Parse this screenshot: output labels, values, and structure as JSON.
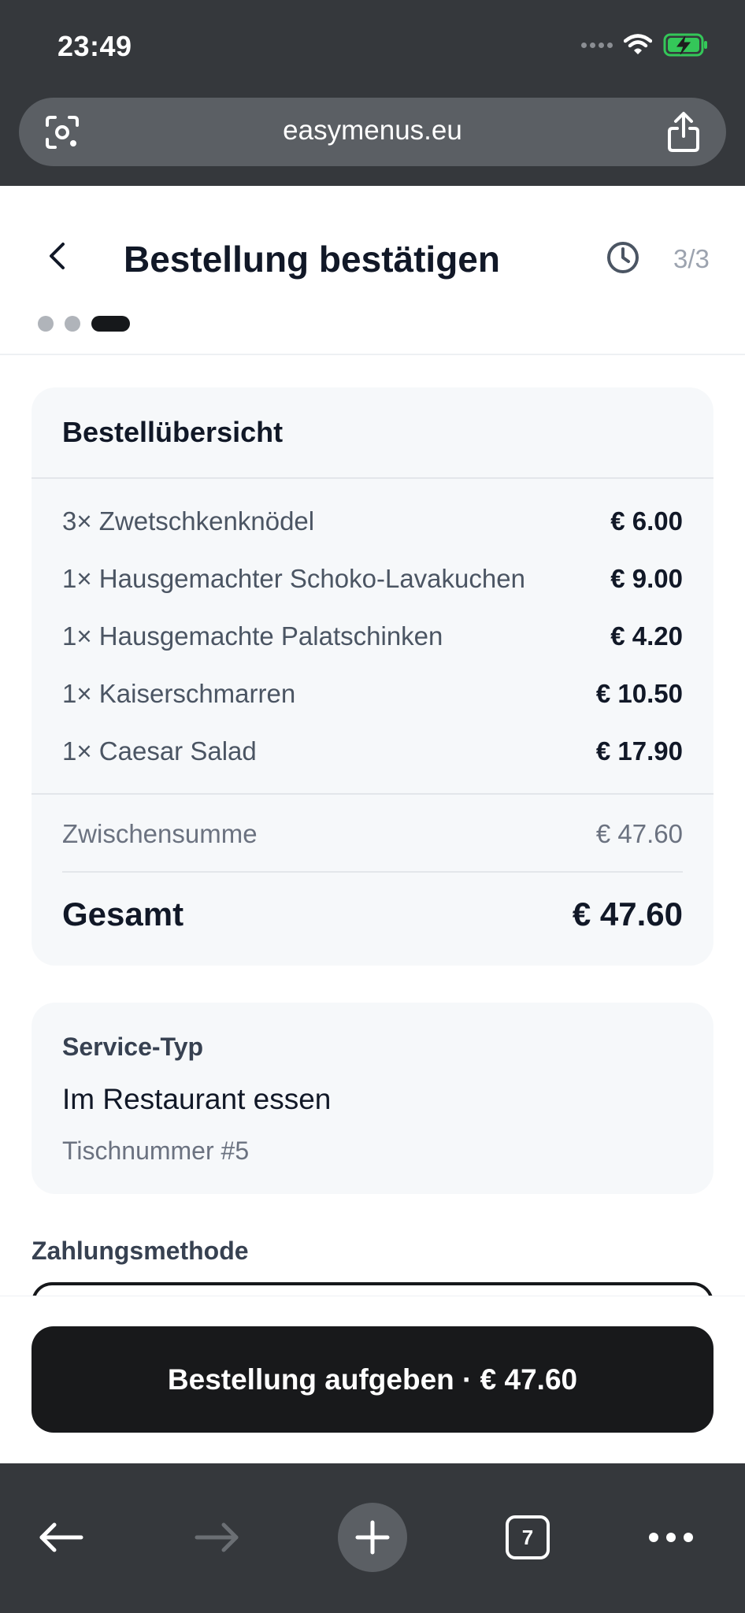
{
  "status_bar": {
    "time": "23:49"
  },
  "browser": {
    "url": "easymenus.eu",
    "tab_count": "7"
  },
  "header": {
    "title": "Bestellung bestätigen",
    "step": "3/3",
    "steps_total": 3,
    "steps_current": 3
  },
  "summary": {
    "title": "Bestellübersicht",
    "items": [
      {
        "name": "3× Zwetschkenknödel",
        "price": "€ 6.00"
      },
      {
        "name": "1× Hausgemachter Schoko-Lavakuchen",
        "price": "€ 9.00"
      },
      {
        "name": "1× Hausgemachte Palatschinken",
        "price": "€ 4.20"
      },
      {
        "name": "1× Kaiserschmarren",
        "price": "€ 10.50"
      },
      {
        "name": "1× Caesar Salad",
        "price": "€ 17.90"
      }
    ],
    "subtotal_label": "Zwischensumme",
    "subtotal_value": "€ 47.60",
    "total_label": "Gesamt",
    "total_value": "€ 47.60"
  },
  "service": {
    "label": "Service-Typ",
    "value": "Im Restaurant essen",
    "table": "Tischnummer #5"
  },
  "payment": {
    "label": "Zahlungsmethode"
  },
  "cta": {
    "label": "Bestellung aufgeben · € 47.60"
  },
  "icons": {
    "camera_search": "camera-search-icon",
    "share": "share-icon",
    "back": "chevron-left-icon",
    "history": "clock-icon",
    "browser_back": "arrow-left-icon",
    "browser_forward": "arrow-right-icon",
    "new_tab": "plus-icon",
    "tabs": "tabs-icon",
    "more": "more-icon"
  },
  "colors": {
    "chrome_bg": "#35383c",
    "primary_button": "#18191b",
    "card_bg": "#f6f8fa",
    "battery_green": "#34c759"
  }
}
